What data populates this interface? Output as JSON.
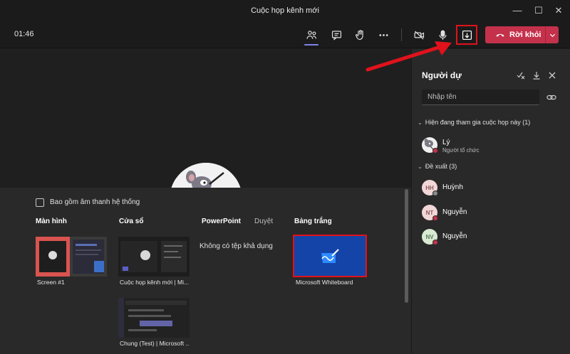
{
  "window": {
    "title": "Cuộc họp kênh mới"
  },
  "toolbar": {
    "timer": "01:46",
    "icons": [
      "participants-icon",
      "chat-icon",
      "raise-hand-icon",
      "more-icon",
      "camera-off-icon",
      "mic-icon",
      "share-tray-icon"
    ],
    "leave_label": "Rời khỏi"
  },
  "share_tray": {
    "include_audio_label": "Bao gồm âm thanh hệ thống",
    "sections": {
      "screen": "Màn hình",
      "window": "Cửa sổ",
      "powerpoint": "PowerPoint",
      "browse": "Duyệt",
      "whiteboard": "Bảng trắng"
    },
    "screens": [
      {
        "caption": "Screen #1"
      }
    ],
    "windows": [
      {
        "caption": "Cuộc họp kênh mới | Mi..."
      },
      {
        "caption": "Chung (Test) | Microsoft ..."
      }
    ],
    "powerpoint_empty": "Không có tệp khả dụng",
    "whiteboard_caption": "Microsoft Whiteboard"
  },
  "participants": {
    "title": "Người dự",
    "search_placeholder": "Nhập tên",
    "in_meeting_header": "Hiện đang tham gia cuộc họp này (1)",
    "suggested_header": "Đề xuất (3)",
    "in_meeting": [
      {
        "name": "Lý",
        "role": "Người tổ chức"
      }
    ],
    "suggested": [
      {
        "initials": "HH",
        "name": "Huỳnh"
      },
      {
        "initials": "NT",
        "name": "Nguyễn"
      },
      {
        "initials": "NV",
        "name": "Nguyễn"
      }
    ]
  },
  "colors": {
    "accent": "#7b83eb",
    "leave": "#c4314b",
    "highlight": "#e0121b",
    "whiteboard": "#1544a8"
  }
}
